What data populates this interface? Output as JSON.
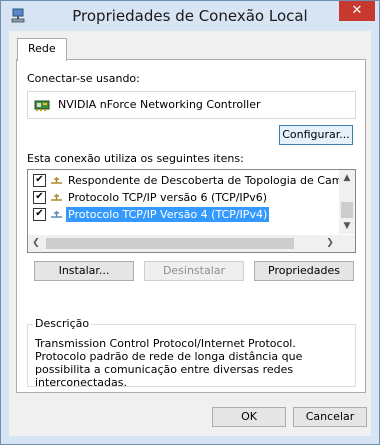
{
  "window": {
    "title": "Propriedades de Conexão Local",
    "close_label": "✕"
  },
  "tabs": [
    {
      "label": "Rede"
    }
  ],
  "connect_using": {
    "label": "Conectar-se usando:",
    "device_name": "NVIDIA nForce Networking Controller",
    "configure_button": "Configurar..."
  },
  "items_section": {
    "label": "Esta conexão utiliza os seguintes itens:",
    "items": [
      {
        "label": "Respondente de Descoberta de Topologia de Camada",
        "checked": true,
        "selected": false
      },
      {
        "label": "Protocolo TCP/IP versão 6 (TCP/IPv6)",
        "checked": true,
        "selected": false
      },
      {
        "label": "Protocolo TCP/IP Versão 4 (TCP/IPv4)",
        "checked": true,
        "selected": true
      }
    ],
    "check_glyph": "✔",
    "scroll_up": "▲",
    "scroll_down": "▼",
    "scroll_left": "❮",
    "scroll_right": "❯"
  },
  "buttons": {
    "install": "Instalar...",
    "uninstall": "Desinstalar",
    "properties": "Propriedades"
  },
  "description": {
    "title": "Descrição",
    "text": "Transmission Control Protocol/Internet Protocol. Protocolo padrão de rede de longa distância que possibilita a comunicação entre diversas redes interconectadas."
  },
  "dialog_buttons": {
    "ok": "OK",
    "cancel": "Cancelar"
  },
  "colors": {
    "selection": "#3399ff",
    "close": "#c7392f",
    "frame": "#d7e4f4"
  }
}
